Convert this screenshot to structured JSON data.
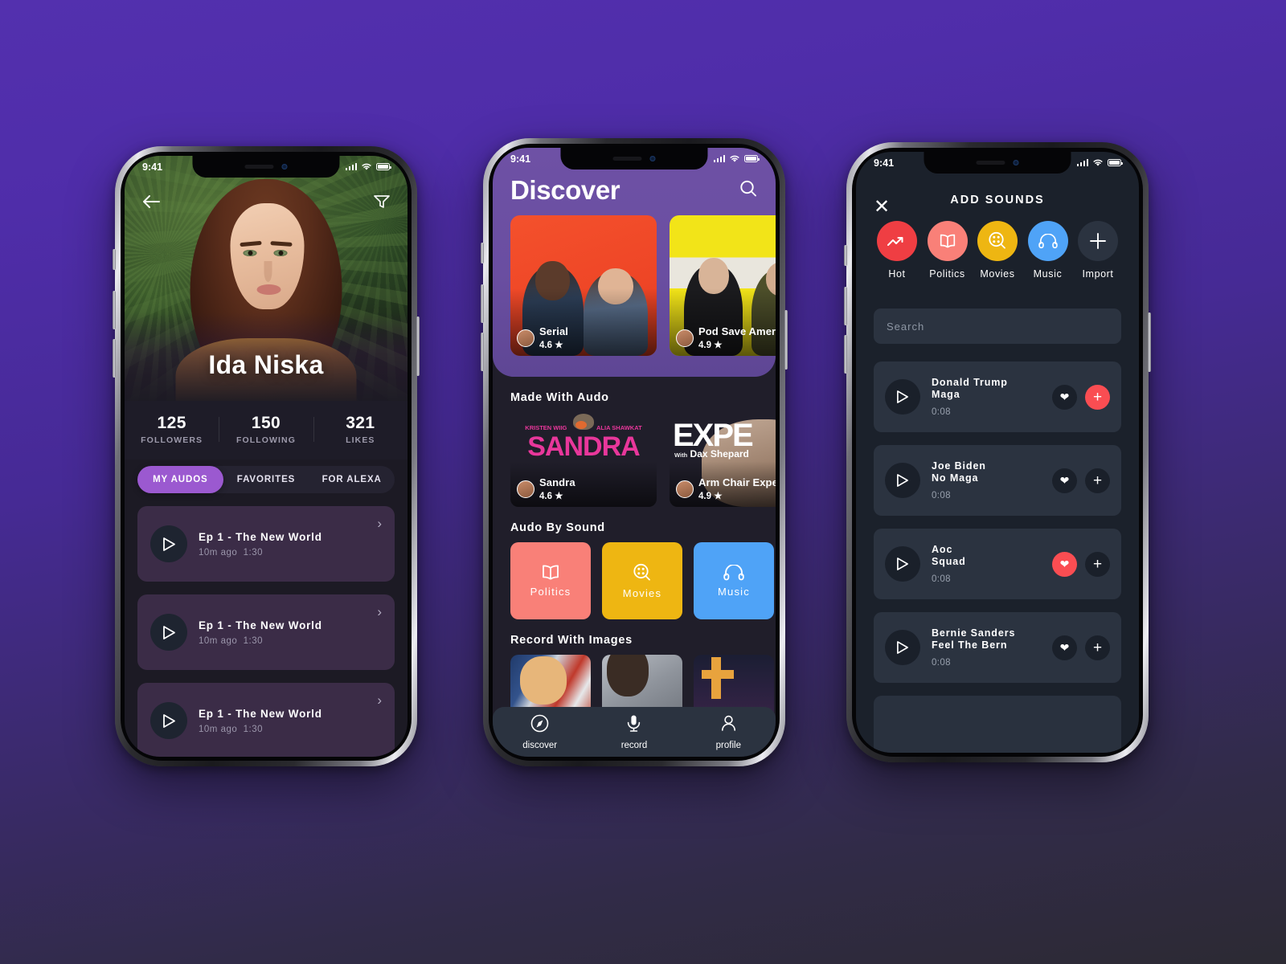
{
  "background": {
    "top_color": "#5330ae",
    "bottom_color": "#2c2a33"
  },
  "phone1": {
    "status": {
      "time": "9:41"
    },
    "header": {
      "back_icon": "arrow-left-icon",
      "filter_icon": "filter-icon",
      "name": "Ida Niska"
    },
    "stats": [
      {
        "num": "125",
        "label": "FOLLOWERS"
      },
      {
        "num": "150",
        "label": "FOLLOWING"
      },
      {
        "num": "321",
        "label": "LIKES"
      }
    ],
    "tabs": [
      {
        "label": "MY AUDOS",
        "active": true
      },
      {
        "label": "FAVORITES",
        "active": false
      },
      {
        "label": "FOR ALEXA",
        "active": false
      }
    ],
    "episodes": [
      {
        "title": "Ep 1 - The New World",
        "ago": "10m ago",
        "duration": "1:30"
      },
      {
        "title": "Ep 1 - The New World",
        "ago": "10m ago",
        "duration": "1:30"
      },
      {
        "title": "Ep 1 - The New World",
        "ago": "10m ago",
        "duration": "1:30"
      }
    ],
    "accent": "#9b59d0"
  },
  "phone2": {
    "status": {
      "time": "9:41"
    },
    "title": "Discover",
    "search_icon": "search-icon",
    "featured": [
      {
        "name": "Serial",
        "rating": "4.6"
      },
      {
        "name": "Pod Save Ameri",
        "rating": "4.9"
      }
    ],
    "sections": [
      {
        "heading": "Made With Audo"
      },
      {
        "heading": "Audo By Sound"
      },
      {
        "heading": "Record With Images"
      }
    ],
    "made_with_audo": [
      {
        "name": "Sandra",
        "rating": "4.6",
        "art_line1": "KRISTEN WIIG",
        "art_line2": "ALIA SHAWKAT",
        "art_title": "SANDRA"
      },
      {
        "name": "Arm Chair Expe",
        "rating": "4.9",
        "art_title": "EXPE",
        "art_sub_small": "With",
        "art_sub": "Dax Shepard"
      }
    ],
    "sounds": [
      {
        "label": "Politics",
        "color": "#f98078",
        "icon": "book-icon"
      },
      {
        "label": "Movies",
        "color": "#eeb612",
        "icon": "film-search-icon"
      },
      {
        "label": "Music",
        "color": "#4fa3f7",
        "icon": "headphones-icon"
      }
    ],
    "tabbar": [
      {
        "label": "discover",
        "icon": "compass-icon",
        "active": true
      },
      {
        "label": "record",
        "icon": "microphone-icon",
        "active": false
      },
      {
        "label": "profile",
        "icon": "person-icon",
        "active": false
      }
    ]
  },
  "phone3": {
    "status": {
      "time": "9:41"
    },
    "close_icon": "close-icon",
    "title": "ADD SOUNDS",
    "categories": [
      {
        "label": "Hot",
        "color": "#ef3e43",
        "icon": "trending-up-icon"
      },
      {
        "label": "Politics",
        "color": "#f98078",
        "icon": "book-icon"
      },
      {
        "label": "Movies",
        "color": "#eeb612",
        "icon": "film-search-icon"
      },
      {
        "label": "Music",
        "color": "#4fa3f7",
        "icon": "headphones-icon"
      },
      {
        "label": "Import",
        "color": "#2b3340",
        "icon": "plus-icon"
      }
    ],
    "search": {
      "placeholder": "Search",
      "value": ""
    },
    "sounds": [
      {
        "name": "Donald Trump",
        "phrase": "Maga",
        "duration": "0:08",
        "liked": false,
        "add_highlight": true
      },
      {
        "name": "Joe Biden",
        "phrase": "No Maga",
        "duration": "0:08",
        "liked": false,
        "add_highlight": false
      },
      {
        "name": "Aoc",
        "phrase": "Squad",
        "duration": "0:08",
        "liked": true,
        "add_highlight": false
      },
      {
        "name": "Bernie Sanders",
        "phrase": "Feel The Bern",
        "duration": "0:08",
        "liked": false,
        "add_highlight": false
      }
    ],
    "accent": "#fa4d52"
  }
}
